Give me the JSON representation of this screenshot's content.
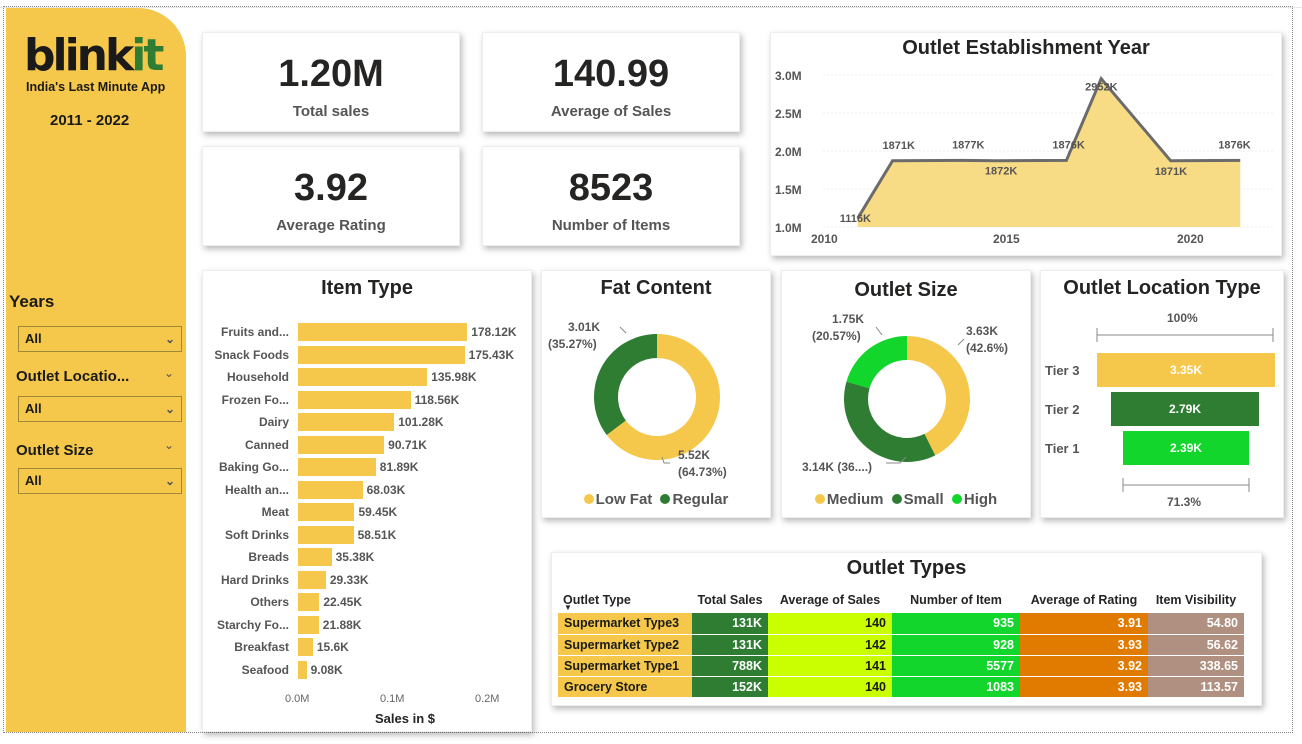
{
  "brand": {
    "logo_main": "blink",
    "logo_accent": "it",
    "tagline": "India's Last Minute App",
    "years_range": "2011 - 2022"
  },
  "filters": {
    "years": {
      "title": "Years",
      "value": "All"
    },
    "outlet_location": {
      "title": "Outlet Locatio...",
      "value": "All"
    },
    "outlet_size": {
      "title": "Outlet Size",
      "value": "All"
    }
  },
  "kpis": {
    "total_sales": {
      "value": "1.20M",
      "label": "Total sales"
    },
    "average_sales": {
      "value": "140.99",
      "label": "Average of Sales"
    },
    "average_rating": {
      "value": "3.92",
      "label": "Average Rating"
    },
    "number_items": {
      "value": "8523",
      "label": "Number of Items"
    }
  },
  "establishment": {
    "title": "Outlet Establishment Year",
    "y_ticks": [
      "3.0M",
      "2.5M",
      "2.0M",
      "1.5M",
      "1.0M"
    ],
    "x_ticks": [
      "2010",
      "2015",
      "2020"
    ],
    "labels": [
      "1116K",
      "1871K",
      "1877K",
      "1872K",
      "1876K",
      "2952K",
      "1871K",
      "1876K"
    ]
  },
  "item_type": {
    "title": "Item Type",
    "axis_ticks": [
      "0.0M",
      "0.1M",
      "0.2M"
    ],
    "axis_label": "Sales in $",
    "rows": [
      {
        "label": "Fruits and...",
        "value_label": "178.12K"
      },
      {
        "label": "Snack Foods",
        "value_label": "175.43K"
      },
      {
        "label": "Household",
        "value_label": "135.98K"
      },
      {
        "label": "Frozen Fo...",
        "value_label": "118.56K"
      },
      {
        "label": "Dairy",
        "value_label": "101.28K"
      },
      {
        "label": "Canned",
        "value_label": "90.71K"
      },
      {
        "label": "Baking Go...",
        "value_label": "81.89K"
      },
      {
        "label": "Health an...",
        "value_label": "68.03K"
      },
      {
        "label": "Meat",
        "value_label": "59.45K"
      },
      {
        "label": "Soft Drinks",
        "value_label": "58.51K"
      },
      {
        "label": "Breads",
        "value_label": "35.38K"
      },
      {
        "label": "Hard Drinks",
        "value_label": "29.33K"
      },
      {
        "label": "Others",
        "value_label": "22.45K"
      },
      {
        "label": "Starchy Fo...",
        "value_label": "21.88K"
      },
      {
        "label": "Breakfast",
        "value_label": "15.6K"
      },
      {
        "label": "Seafood",
        "value_label": "9.08K"
      }
    ]
  },
  "fat_content": {
    "title": "Fat Content",
    "label_regular": "3.01K",
    "label_regular_pct": "(35.27%)",
    "label_lowfat": "5.52K",
    "label_lowfat_pct": "(64.73%)",
    "legend": [
      "Low Fat",
      "Regular"
    ]
  },
  "outlet_size": {
    "title": "Outlet Size",
    "label_high": "1.75K",
    "label_high_pct": "(20.57%)",
    "label_medium": "3.63K",
    "label_medium_pct": "(42.6%)",
    "label_small": "3.14K (36....)",
    "legend": [
      "Medium",
      "Small",
      "High"
    ]
  },
  "location_type": {
    "title": "Outlet Location Type",
    "top_pct": "100%",
    "bottom_pct": "71.3%",
    "tiers": [
      {
        "name": "Tier 3",
        "value": "3.35K"
      },
      {
        "name": "Tier 2",
        "value": "2.79K"
      },
      {
        "name": "Tier 1",
        "value": "2.39K"
      }
    ]
  },
  "outlet_types": {
    "title": "Outlet Types",
    "headers": [
      "Outlet Type",
      "Total Sales",
      "Average  of Sales",
      "Number of Item",
      "Average of Rating",
      "Item Visibility"
    ],
    "rows": [
      [
        "Supermarket Type3",
        "131K",
        "140",
        "935",
        "3.91",
        "54.80"
      ],
      [
        "Supermarket Type2",
        "131K",
        "142",
        "928",
        "3.93",
        "56.62"
      ],
      [
        "Supermarket Type1",
        "788K",
        "141",
        "5577",
        "3.92",
        "338.65"
      ],
      [
        "Grocery Store",
        "152K",
        "140",
        "1083",
        "3.93",
        "113.57"
      ]
    ]
  },
  "colors": {
    "yellow": "#f5c84b",
    "dark_green": "#2e7d32",
    "bright_green": "#12d62b",
    "lime": "#c9ff00",
    "orange": "#e07b00",
    "taupe": "#b09080"
  },
  "chart_data": [
    {
      "type": "bar",
      "title": "Item Type",
      "xlabel": "Sales in $",
      "xlim": [
        0,
        0.2
      ],
      "categories": [
        "Fruits and...",
        "Snack Foods",
        "Household",
        "Frozen Fo...",
        "Dairy",
        "Canned",
        "Baking Go...",
        "Health an...",
        "Meat",
        "Soft Drinks",
        "Breads",
        "Hard Drinks",
        "Others",
        "Starchy Fo...",
        "Breakfast",
        "Seafood"
      ],
      "values": [
        178.12,
        175.43,
        135.98,
        118.56,
        101.28,
        90.71,
        81.89,
        68.03,
        59.45,
        58.51,
        35.38,
        29.33,
        22.45,
        21.88,
        15.6,
        9.08
      ]
    },
    {
      "type": "area",
      "title": "Outlet Establishment Year",
      "x": [
        2011,
        2012,
        2014,
        2015,
        2017,
        2018,
        2020,
        2022
      ],
      "values": [
        1116,
        1871,
        1877,
        1872,
        1876,
        2952,
        1871,
        1876
      ],
      "ylim": [
        1.0,
        3.0
      ]
    },
    {
      "type": "pie",
      "title": "Fat Content",
      "categories": [
        "Low Fat",
        "Regular"
      ],
      "values": [
        5.52,
        3.01
      ]
    },
    {
      "type": "pie",
      "title": "Outlet Size",
      "categories": [
        "Medium",
        "Small",
        "High"
      ],
      "values": [
        3.63,
        3.14,
        1.75
      ]
    },
    {
      "type": "bar",
      "title": "Outlet Location Type",
      "categories": [
        "Tier 3",
        "Tier 2",
        "Tier 1"
      ],
      "values": [
        3.35,
        2.79,
        2.39
      ]
    }
  ]
}
